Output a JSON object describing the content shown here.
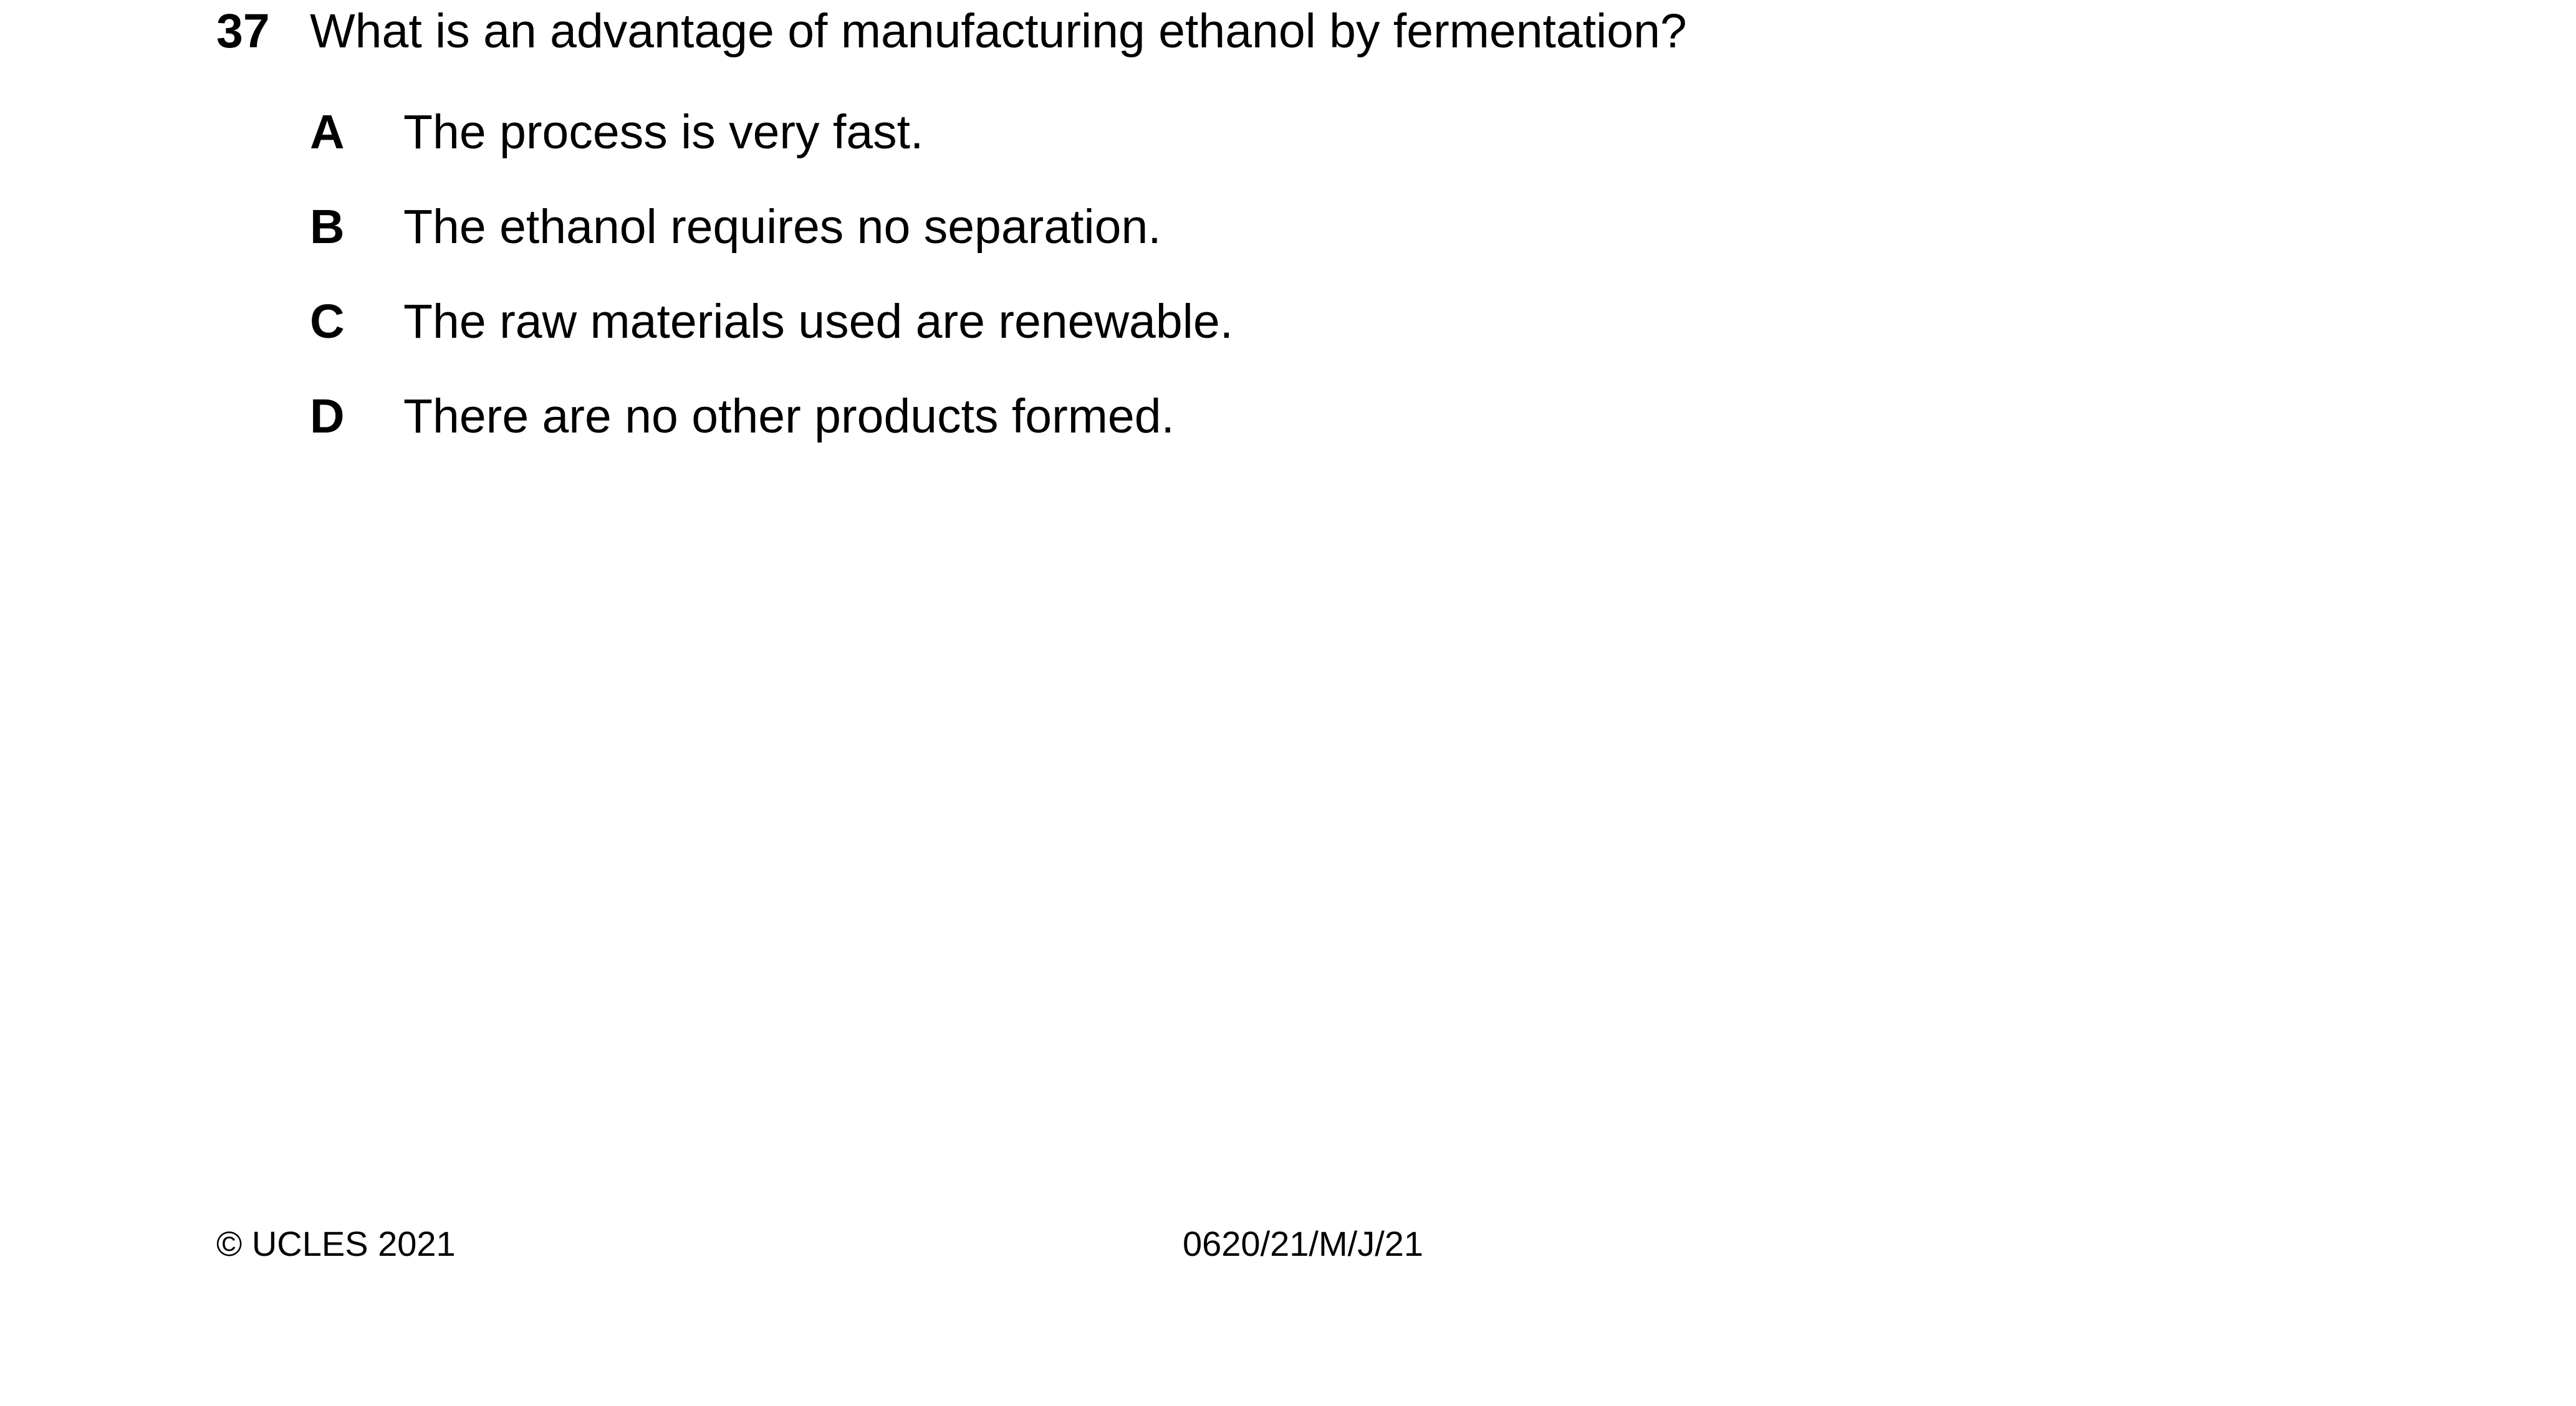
{
  "question": {
    "number": "37",
    "text": "What is an advantage of manufacturing ethanol by fermentation?",
    "options": [
      {
        "letter": "A",
        "text": "The process is very fast."
      },
      {
        "letter": "B",
        "text": "The ethanol requires no separation."
      },
      {
        "letter": "C",
        "text": "The raw materials used are renewable."
      },
      {
        "letter": "D",
        "text": "There are no other products formed."
      }
    ]
  },
  "footer": {
    "copyright": "© UCLES 2021",
    "paper_code": "0620/21/M/J/21"
  }
}
